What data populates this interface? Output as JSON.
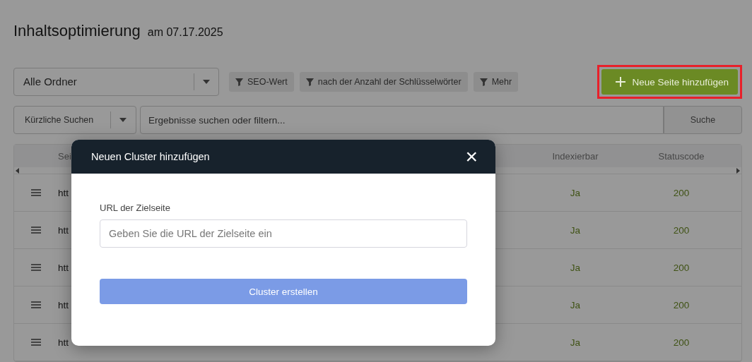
{
  "header": {
    "title": "Inhaltsoptimierung",
    "date": "am 07.17.2025"
  },
  "folder_select": {
    "value": "Alle Ordner"
  },
  "filters": [
    {
      "label": "SEO-Wert"
    },
    {
      "label": "nach der Anzahl der Schlüsselwörter"
    },
    {
      "label": "Mehr"
    }
  ],
  "add_button": {
    "label": "Neue Seite hinzufügen",
    "highlighted": true
  },
  "search": {
    "recent": "Kürzliche Suchen",
    "placeholder": "Ergebnisse suchen oder filtern...",
    "button": "Suche"
  },
  "table": {
    "columns": [
      "Sei",
      "Indexierbar",
      "Statuscode"
    ],
    "rows": [
      {
        "url": "htt",
        "indexable": "Ja",
        "status": "200"
      },
      {
        "url": "htt",
        "indexable": "Ja",
        "status": "200"
      },
      {
        "url": "htt",
        "indexable": "Ja",
        "status": "200"
      },
      {
        "url": "htt",
        "indexable": "Ja",
        "status": "200"
      },
      {
        "url": "htt",
        "indexable": "Ja",
        "status": "200"
      }
    ]
  },
  "modal": {
    "title": "Neuen Cluster hinzufügen",
    "field_label": "URL der Zielseite",
    "placeholder": "Geben Sie die URL der Zielseite ein",
    "submit": "Cluster erstellen",
    "close": "×"
  }
}
